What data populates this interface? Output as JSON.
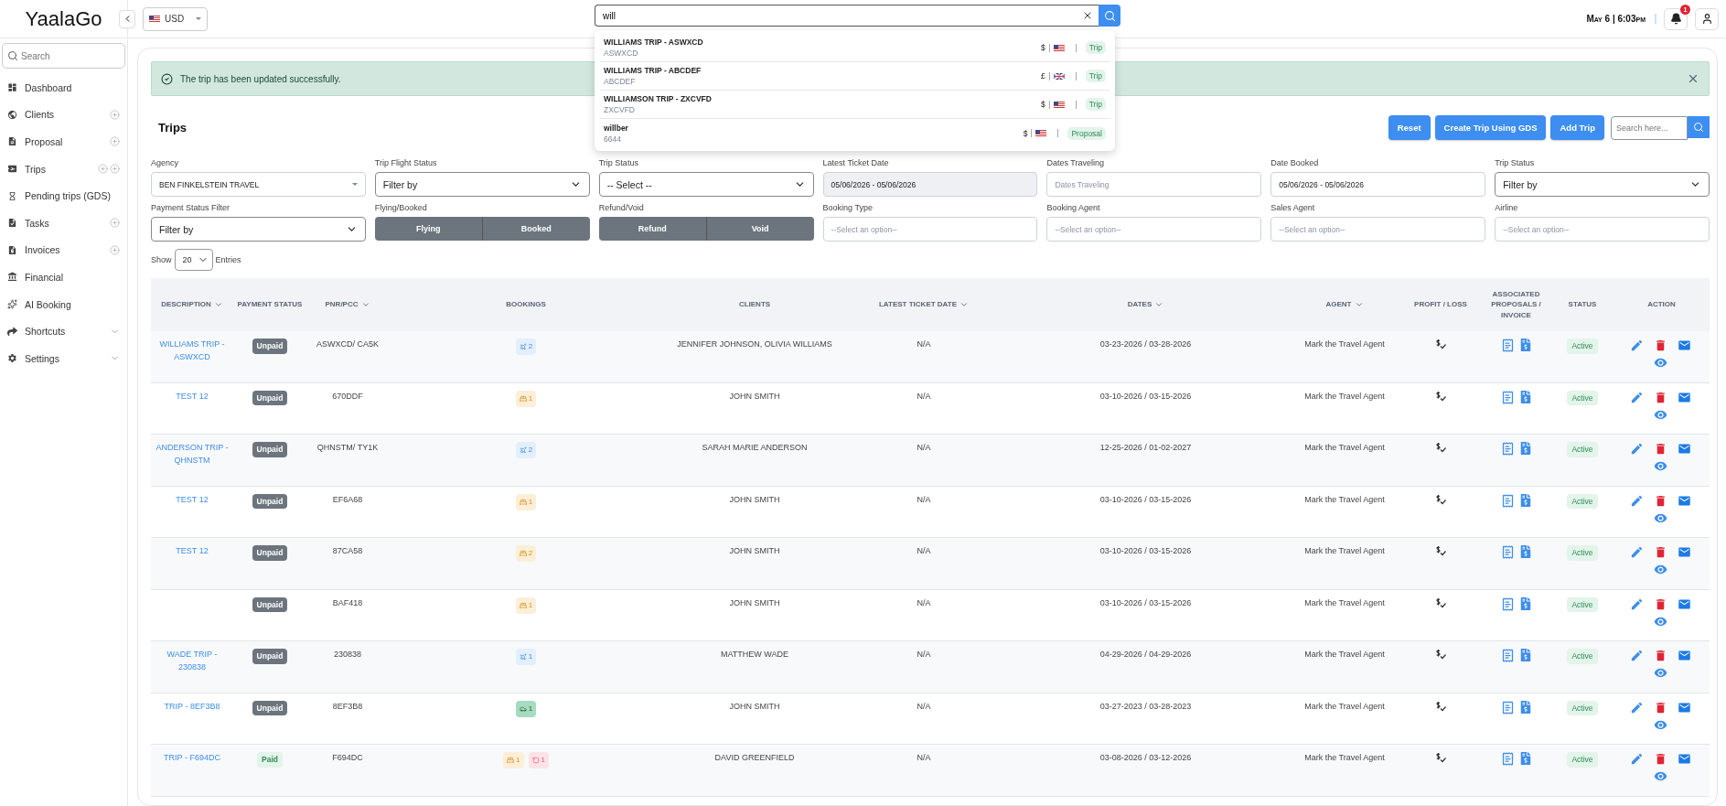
{
  "header": {
    "logo": "YaalaGo",
    "currency": "USD",
    "search": {
      "value": "will"
    },
    "datetime": "May 6 | 6:03pm",
    "notification_count": "1"
  },
  "search_results": [
    {
      "title": "WILLIAMS TRIP - ASWXCD",
      "code": "ASWXCD",
      "currency": "$",
      "kind": "us",
      "type": "Trip"
    },
    {
      "title": "WILLIAMS TRIP - ABCDEF",
      "code": "ABCDEF",
      "currency": "£",
      "kind": "uk",
      "type": "Trip"
    },
    {
      "title": "WILLIAMSON TRIP - ZXCVFD",
      "code": "ZXCVFD",
      "currency": "$",
      "kind": "us",
      "type": "Trip"
    },
    {
      "title": "willber",
      "code": "6644",
      "currency": "$",
      "kind": "us",
      "type": "Proposal"
    }
  ],
  "sidebar": {
    "search": {
      "placeholder": "Search"
    },
    "items": [
      {
        "label": "Dashboard"
      },
      {
        "label": "Clients",
        "trailing": [
          {
            "kind": "plus"
          }
        ]
      },
      {
        "label": "Proposal",
        "trailing": [
          {
            "kind": "plus"
          }
        ]
      },
      {
        "label": "Trips",
        "trailing": [
          {
            "kind": "plus"
          },
          {
            "kind": "plus"
          }
        ]
      },
      {
        "label": "Pending trips (GDS)"
      },
      {
        "label": "Tasks",
        "trailing": [
          {
            "kind": "plus"
          }
        ]
      },
      {
        "label": "Invoices",
        "trailing": [
          {
            "kind": "plus"
          }
        ]
      },
      {
        "label": "Financial"
      },
      {
        "label": "AI Booking"
      },
      {
        "label": "Shortcuts",
        "trailing": [
          {
            "kind": "chevron"
          }
        ]
      },
      {
        "label": "Settings",
        "trailing": [
          {
            "kind": "chevron"
          }
        ]
      }
    ]
  },
  "alert": {
    "message": "The trip has been updated successfully."
  },
  "page": {
    "title": "Trips",
    "buttons": [
      "Reset",
      "Create Trip Using GDS",
      "Add Trip"
    ],
    "search": {
      "placeholder": "Search here..."
    }
  },
  "filters": [
    {
      "label": "Agency",
      "kind": "combo",
      "value": "BEN FINKELSTEIN TRAVEL"
    },
    {
      "label": "Trip Flight Status",
      "kind": "select",
      "value": "Filter by"
    },
    {
      "label": "Trip Status",
      "kind": "select",
      "value": "-- Select --"
    },
    {
      "label": "Latest Ticket Date",
      "kind": "input",
      "value": "05/06/2026 - 05/06/2026",
      "disabled": true
    },
    {
      "label": "Dates Traveling",
      "kind": "input",
      "placeholder": "Dates Traveling",
      "disabled": false
    },
    {
      "label": "Date Booked",
      "kind": "input",
      "value": "05/06/2026 - 05/06/2026",
      "disabled": false
    },
    {
      "label": "Trip Status",
      "kind": "select",
      "value": "Filter by"
    },
    {
      "label": "Payment Status Filter",
      "kind": "select",
      "value": "Filter by"
    },
    {
      "label": "Flying/Booked",
      "kind": "toggle",
      "options": [
        "Flying",
        "Booked"
      ]
    },
    {
      "label": "Refund/Void",
      "kind": "toggle",
      "options": [
        "Refund",
        "Void"
      ]
    },
    {
      "label": "Booking Type",
      "kind": "input",
      "placeholder": "--Select an option--",
      "disabled": false
    },
    {
      "label": "Booking Agent",
      "kind": "input",
      "placeholder": "--Select an option--",
      "disabled": false
    },
    {
      "label": "Sales Agent",
      "kind": "input",
      "placeholder": "--Select an option--",
      "disabled": false
    },
    {
      "label": "Airline",
      "kind": "input",
      "placeholder": "--Select an option--",
      "disabled": false
    }
  ],
  "entries": {
    "before": "Show",
    "value": "20",
    "after": "Entries"
  },
  "table": {
    "columns": [
      {
        "label": "DESCRIPTION",
        "sortable": true
      },
      {
        "label": "PAYMENT STATUS",
        "sortable": false
      },
      {
        "label": "PNR/PCC",
        "sortable": true
      },
      {
        "label": "BOOKINGS",
        "sortable": false
      },
      {
        "label": "CLIENTS",
        "sortable": false
      },
      {
        "label": "LATEST TICKET DATE",
        "sortable": true
      },
      {
        "label": "DATES",
        "sortable": true
      },
      {
        "label": "AGENT",
        "sortable": true
      },
      {
        "label": "PROFIT / LOSS",
        "sortable": false
      },
      {
        "label": "ASSOCIATED PROPOSALS / INVOICE",
        "sortable": false
      },
      {
        "label": "STATUS",
        "sortable": false
      },
      {
        "label": "ACTION",
        "sortable": false
      }
    ],
    "rows": [
      {
        "description": "WILLIAMS TRIP - ASWXCD",
        "payment": {
          "label": "Unpaid",
          "kind": "unpaid"
        },
        "pnr": "ASWXCD/ CA5K",
        "bookings": [
          {
            "kind": "flight",
            "count": "2"
          }
        ],
        "clients": "JENNIFER JOHNSON, OLIVIA WILLIAMS",
        "latest_ticket_date": "N/A",
        "dates": "03-23-2026 / 03-28-2026",
        "agent": "Mark the Travel Agent",
        "status": "Active"
      },
      {
        "description": "TEST 12",
        "payment": {
          "label": "Unpaid",
          "kind": "unpaid"
        },
        "pnr": "670DDF",
        "bookings": [
          {
            "kind": "hotel",
            "count": "1"
          }
        ],
        "clients": "JOHN SMITH",
        "latest_ticket_date": "N/A",
        "dates": "03-10-2026 / 03-15-2026",
        "agent": "Mark the Travel Agent",
        "status": "Active"
      },
      {
        "description": "ANDERSON TRIP - QHNSTM",
        "payment": {
          "label": "Unpaid",
          "kind": "unpaid"
        },
        "pnr": "QHNSTM/ TY1K",
        "bookings": [
          {
            "kind": "flight",
            "count": "2"
          }
        ],
        "clients": "SARAH MARIE ANDERSON",
        "latest_ticket_date": "N/A",
        "dates": "12-25-2026 / 01-02-2027",
        "agent": "Mark the Travel Agent",
        "status": "Active"
      },
      {
        "description": "TEST 12",
        "payment": {
          "label": "Unpaid",
          "kind": "unpaid"
        },
        "pnr": "EF6A68",
        "bookings": [
          {
            "kind": "hotel",
            "count": "1"
          }
        ],
        "clients": "JOHN SMITH",
        "latest_ticket_date": "N/A",
        "dates": "03-10-2026 / 03-15-2026",
        "agent": "Mark the Travel Agent",
        "status": "Active"
      },
      {
        "description": "TEST 12",
        "payment": {
          "label": "Unpaid",
          "kind": "unpaid"
        },
        "pnr": "87CA58",
        "bookings": [
          {
            "kind": "hotel",
            "count": "2"
          }
        ],
        "clients": "JOHN SMITH",
        "latest_ticket_date": "N/A",
        "dates": "03-10-2026 / 03-15-2026",
        "agent": "Mark the Travel Agent",
        "status": "Active"
      },
      {
        "payment": {
          "label": "Unpaid",
          "kind": "unpaid"
        },
        "pnr": "BAF418",
        "bookings": [
          {
            "kind": "hotel",
            "count": "1"
          }
        ],
        "clients": "JOHN SMITH",
        "latest_ticket_date": "N/A",
        "dates": "03-10-2026 / 03-15-2026",
        "agent": "Mark the Travel Agent",
        "status": "Active"
      },
      {
        "description": "WADE TRIP - 230838",
        "payment": {
          "label": "Unpaid",
          "kind": "unpaid"
        },
        "pnr": "230838",
        "bookings": [
          {
            "kind": "flight",
            "count": "1"
          }
        ],
        "clients": "MATTHEW WADE",
        "latest_ticket_date": "N/A",
        "dates": "04-29-2026 / 04-29-2026",
        "agent": "Mark the Travel Agent",
        "status": "Active"
      },
      {
        "description": "TRIP - 8EF3B8",
        "payment": {
          "label": "Unpaid",
          "kind": "unpaid"
        },
        "pnr": "8EF3B8",
        "bookings": [
          {
            "kind": "car",
            "count": "1"
          }
        ],
        "clients": "JOHN SMITH",
        "latest_ticket_date": "N/A",
        "dates": "03-27-2023 / 03-28-2023",
        "agent": "Mark the Travel Agent",
        "status": "Active"
      },
      {
        "description": "TRIP - F694DC",
        "payment": {
          "label": "Paid",
          "kind": "paid"
        },
        "pnr": "F694DC",
        "bookings": [
          {
            "kind": "hotel",
            "count": "1"
          },
          {
            "kind": "refund",
            "count": "1"
          }
        ],
        "clients": "DAVID GREENFIELD",
        "latest_ticket_date": "N/A",
        "dates": "03-08-2026 / 03-12-2026",
        "agent": "Mark the Travel Agent",
        "status": "Active"
      }
    ]
  }
}
